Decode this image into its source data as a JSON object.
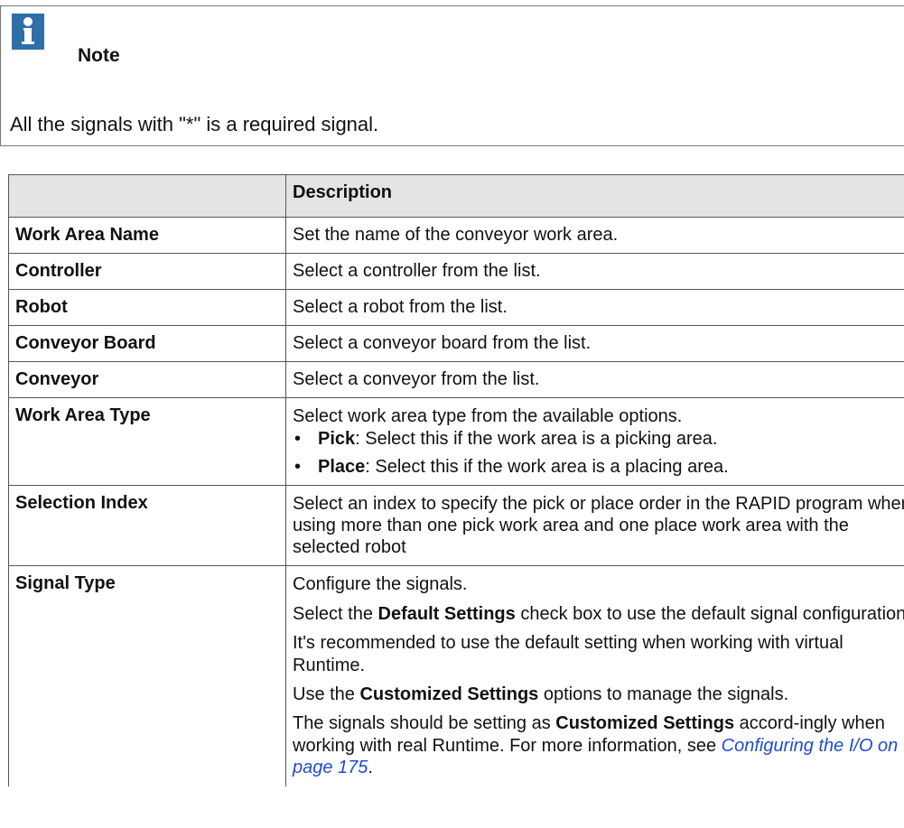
{
  "note": {
    "title": "Note",
    "text": "All the signals with \"*\" is a required signal."
  },
  "table": {
    "headers": [
      "",
      "Description"
    ],
    "rows": [
      {
        "name": "Work Area Name",
        "description": "Set the name of the conveyor work area."
      },
      {
        "name": "Controller",
        "description": "Select a controller from the list."
      },
      {
        "name": "Robot",
        "description": "Select a robot from the list."
      },
      {
        "name": "Conveyor Board",
        "description": "Select a conveyor board from the list."
      },
      {
        "name": "Conveyor",
        "description": "Select a conveyor from the list."
      },
      {
        "name": "Work Area Type",
        "description": "Select work area type from the available options.",
        "bullets": [
          {
            "term": "Pick",
            "text": ": Select this if the work area is a picking area."
          },
          {
            "term": "Place",
            "text": ": Select this if the work area is a placing area."
          }
        ]
      },
      {
        "name": "Selection Index",
        "description": "Select an index to specify the pick or place order in the RAPID program when using more than one pick work area and one place work area with the selected robot"
      },
      {
        "name": "Signal Type",
        "p1": "Configure the signals.",
        "p2_pre": "Select the ",
        "p2_bold": "Default Settings",
        "p2_post": " check box to use the default signal configuration.",
        "p3": "It's recommended to use the default setting when working with virtual Runtime.",
        "p4_pre": "Use the ",
        "p4_bold": "Customized Settings",
        "p4_post": " options to manage the signals.",
        "p5_pre": "The signals should be setting as ",
        "p5_bold": "Customized Settings",
        "p5_post": " accord-ingly when working with real Runtime. For more information, see ",
        "p5_link": "Configuring the I/O on page 175",
        "p5_end": "."
      }
    ]
  },
  "colors": {
    "note_icon": "#2f6fa8",
    "header_bg": "#e4e4e4",
    "link": "#1f4ccf"
  },
  "icons": {
    "note": "info-icon"
  }
}
